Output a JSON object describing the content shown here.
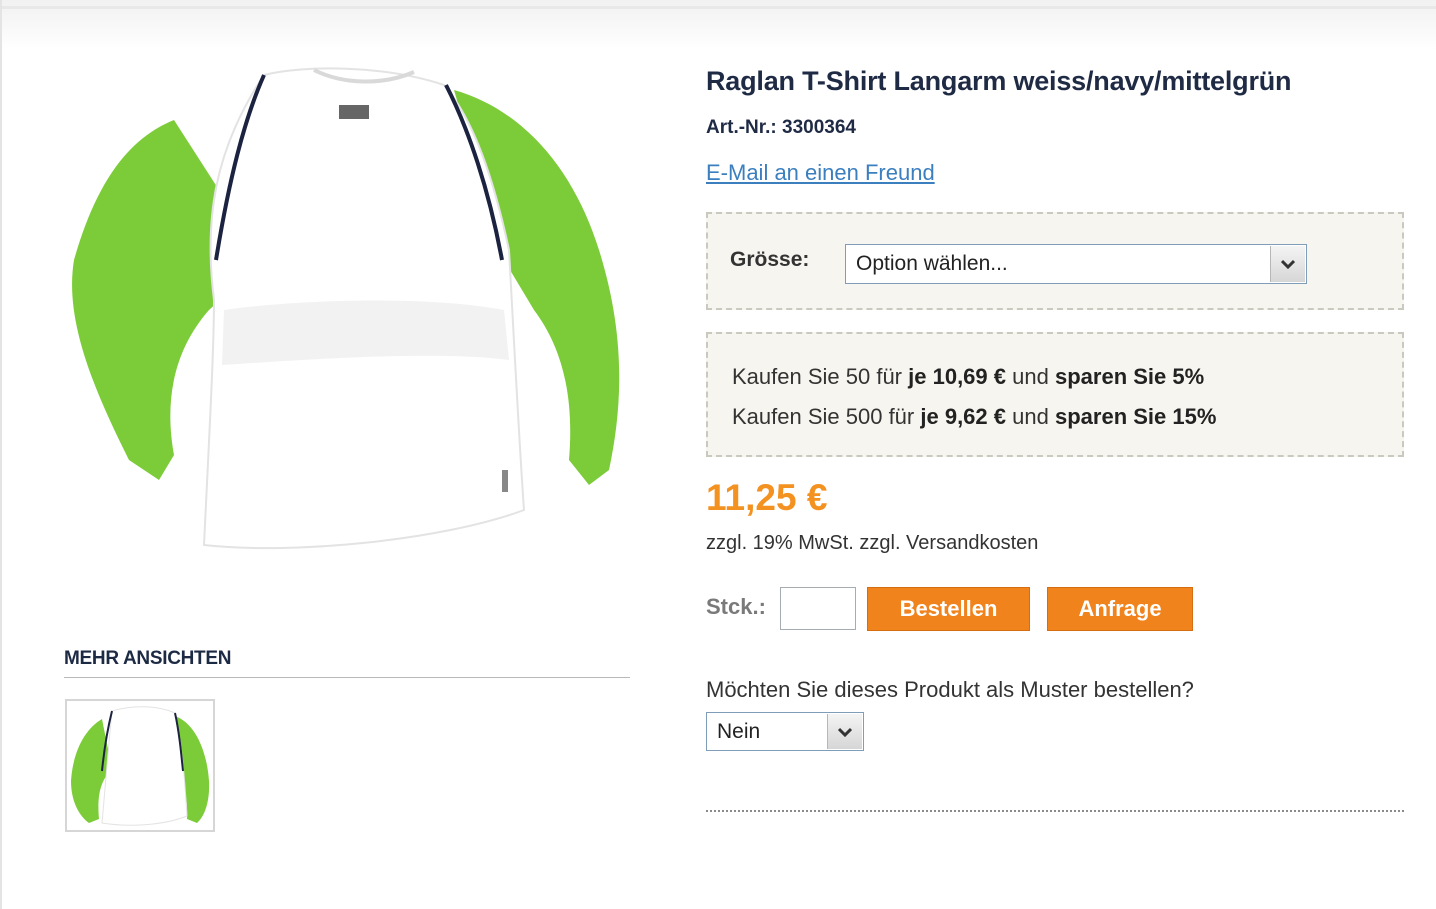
{
  "product": {
    "title": "Raglan T-Shirt Langarm weiss/navy/mittelgrün",
    "sku_label": "Art.-Nr.:",
    "sku_value": "3300364",
    "email_link": "E-Mail an einen Freund",
    "colors": {
      "body": "#ffffff",
      "sleeves": "#7ccc3a",
      "piping": "#1b2340"
    }
  },
  "options": {
    "size_label": "Grösse:",
    "size_selected": "Option wählen..."
  },
  "tier_prices": [
    {
      "prefix": "Kaufen Sie 50 für",
      "price": "je 10,69 €",
      "middle": "und",
      "saving": "sparen Sie 5%"
    },
    {
      "prefix": "Kaufen Sie 500 für",
      "price": "je 9,62 €",
      "middle": "und",
      "saving": "sparen Sie 15%"
    }
  ],
  "pricing": {
    "price": "11,25 €",
    "tax_note": "zzgl. 19% MwSt. zzgl. Versandkosten",
    "price_color": "#f39220"
  },
  "purchase": {
    "qty_label": "Stck.:",
    "qty_value": "",
    "order_button": "Bestellen",
    "request_button": "Anfrage",
    "button_color": "#f0831c"
  },
  "sample": {
    "question": "Möchten Sie dieses Produkt als Muster bestellen?",
    "selected": "Nein"
  },
  "gallery": {
    "more_views_title": "MEHR ANSICHTEN"
  }
}
